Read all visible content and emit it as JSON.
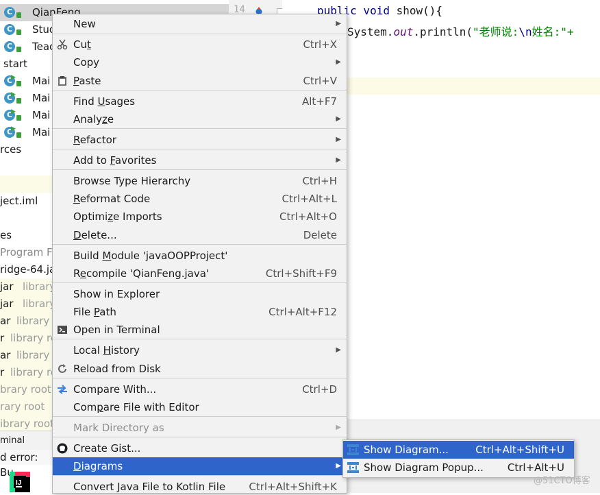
{
  "project_tree": [
    {
      "label": "QianFeng",
      "icon": "class-icon",
      "selected": true
    },
    {
      "label": "Stud",
      "icon": "class-icon"
    },
    {
      "label": "Teac",
      "icon": "class-icon"
    },
    {
      "label": "start",
      "icon": "none"
    },
    {
      "label": "Mai",
      "icon": "runnable-class-icon"
    },
    {
      "label": "Mai",
      "icon": "runnable-class-icon"
    },
    {
      "label": "Mai",
      "icon": "runnable-class-icon"
    },
    {
      "label": "Mai",
      "icon": "runnable-class-icon"
    },
    {
      "label": "rces",
      "icon": "none"
    },
    {
      "label": "",
      "icon": "none",
      "highlight": true
    },
    {
      "label": "ject.iml",
      "icon": "none"
    },
    {
      "label": "",
      "icon": "none"
    },
    {
      "label": "es",
      "icon": "none"
    },
    {
      "label": "Program Fil",
      "icon": "none",
      "grey": true
    },
    {
      "label": "ridge-64.ja",
      "icon": "none"
    },
    {
      "label": "jar",
      "suffix": "library",
      "icon": "none"
    },
    {
      "label": "jar",
      "suffix": "library",
      "icon": "none"
    },
    {
      "label": "ar",
      "suffix": "library ro",
      "icon": "none"
    },
    {
      "label": "r",
      "suffix": "library ro",
      "icon": "none"
    },
    {
      "label": "ar",
      "suffix": "library r",
      "icon": "none"
    },
    {
      "label": "r",
      "suffix": "library ro",
      "icon": "none"
    },
    {
      "label": "",
      "suffix": "brary root",
      "icon": "none"
    },
    {
      "label": "",
      "suffix": "rary root",
      "icon": "none"
    },
    {
      "label": "",
      "suffix": "ibrary root",
      "icon": "none"
    }
  ],
  "editor": {
    "line_number": "14",
    "code_line1": {
      "kw": "public void",
      "rest": " show(){"
    },
    "code_line2": {
      "pre": "System.",
      "field": "out",
      "mid": ".println(",
      "str_open": "\"老师说:",
      "esc": "\\n",
      "str_rest": "姓名:\"+"
    }
  },
  "bottom": {
    "terminal_label": "minal",
    "build_error": "d error: Bu"
  },
  "context_menu": [
    {
      "label": "New",
      "shortcut": "",
      "submenu": true,
      "icon": ""
    },
    {
      "sep": true
    },
    {
      "label": "Cut",
      "shortcut": "Ctrl+X",
      "icon": "scissors-icon",
      "u": "t"
    },
    {
      "label": "Copy",
      "shortcut": "",
      "submenu": true,
      "icon": ""
    },
    {
      "label": "Paste",
      "shortcut": "Ctrl+V",
      "icon": "clipboard-icon",
      "u": "P"
    },
    {
      "sep": true
    },
    {
      "label": "Find Usages",
      "shortcut": "Alt+F7"
    },
    {
      "label": "Analyze",
      "submenu": true
    },
    {
      "sep": true
    },
    {
      "label": "Refactor",
      "submenu": true
    },
    {
      "sep": true
    },
    {
      "label": "Add to Favorites",
      "submenu": true
    },
    {
      "sep": true
    },
    {
      "label": "Browse Type Hierarchy",
      "shortcut": "Ctrl+H"
    },
    {
      "label": "Reformat Code",
      "shortcut": "Ctrl+Alt+L"
    },
    {
      "label": "Optimize Imports",
      "shortcut": "Ctrl+Alt+O"
    },
    {
      "label": "Delete...",
      "shortcut": "Delete"
    },
    {
      "sep": true
    },
    {
      "label": "Build Module 'javaOOPProject'",
      "shortcut": ""
    },
    {
      "label": "Recompile 'QianFeng.java'",
      "shortcut": "Ctrl+Shift+F9"
    },
    {
      "sep": true
    },
    {
      "label": "Show in Explorer",
      "shortcut": ""
    },
    {
      "label": "File Path",
      "shortcut": "Ctrl+Alt+F12"
    },
    {
      "label": "Open in Terminal",
      "shortcut": "",
      "icon": "terminal-icon"
    },
    {
      "sep": true
    },
    {
      "label": "Local History",
      "submenu": true
    },
    {
      "label": "Reload from Disk",
      "shortcut": "",
      "icon": "reload-icon"
    },
    {
      "sep": true
    },
    {
      "label": "Compare With...",
      "shortcut": "Ctrl+D",
      "icon": "compare-icon"
    },
    {
      "label": "Compare File with Editor",
      "shortcut": ""
    },
    {
      "sep": true
    },
    {
      "label": "Mark Directory as",
      "submenu": true,
      "disabled": true
    },
    {
      "sep": true
    },
    {
      "label": "Create Gist...",
      "shortcut": "",
      "icon": "github-icon"
    },
    {
      "label": "Diagrams",
      "submenu": true,
      "hover": true
    },
    {
      "sep": true
    },
    {
      "label": "Convert Java File to Kotlin File",
      "shortcut": "Ctrl+Alt+Shift+K"
    }
  ],
  "diagrams_submenu": [
    {
      "label": "Show Diagram...",
      "shortcut": "Ctrl+Alt+Shift+U",
      "hover": true
    },
    {
      "label": "Show Diagram Popup...",
      "shortcut": "Ctrl+Alt+U"
    }
  ],
  "watermark": "@51CTO博客",
  "colors": {
    "menu_bg": "#f2f2f2",
    "hover": "#2f65ca",
    "class_icon": "#3f96c4"
  }
}
